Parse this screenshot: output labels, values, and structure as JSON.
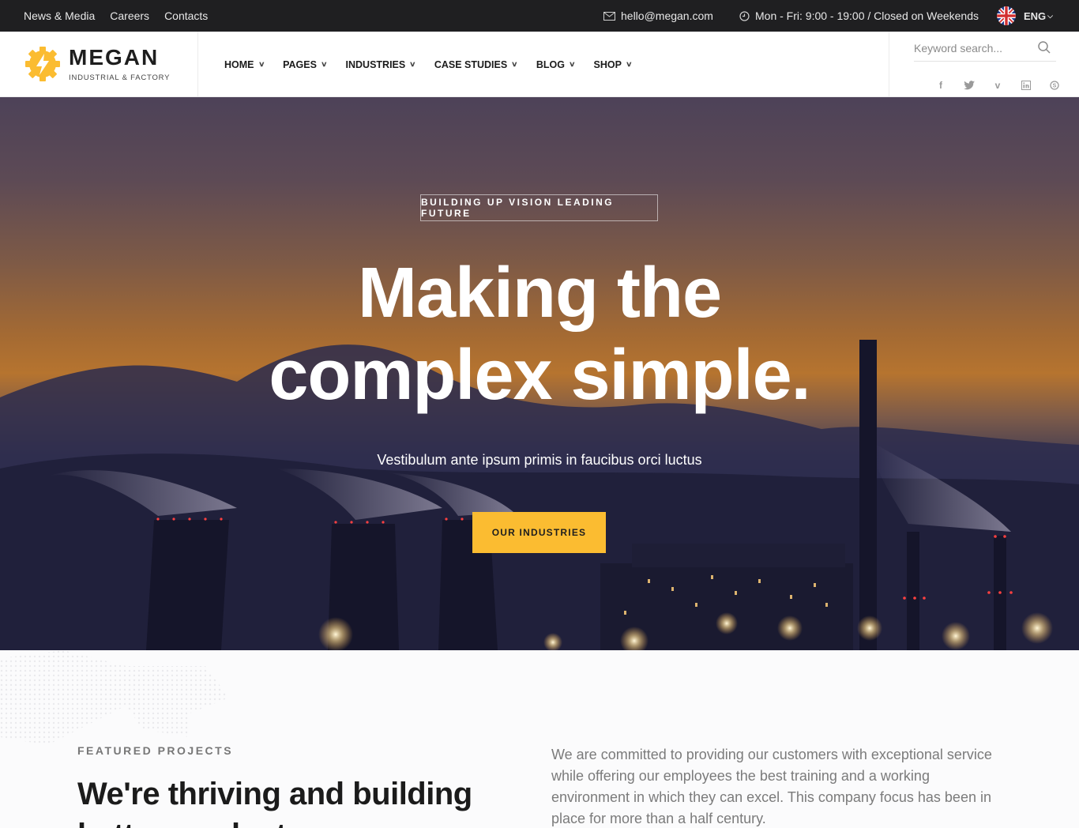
{
  "topbar": {
    "links": [
      "News & Media",
      "Careers",
      "Contacts"
    ],
    "email": "hello@megan.com",
    "hours": "Mon - Fri: 9:00 - 19:00 / Closed on Weekends",
    "language": "ENG"
  },
  "brand": {
    "name": "MEGAN",
    "tagline": "INDUSTRIAL & FACTORY",
    "accent_color": "#fbbc31"
  },
  "nav": {
    "items": [
      "HOME",
      "PAGES",
      "INDUSTRIES",
      "CASE STUDIES",
      "BLOG",
      "SHOP"
    ]
  },
  "search": {
    "placeholder": "Keyword search..."
  },
  "socials": [
    "facebook-icon",
    "twitter-icon",
    "vimeo-icon",
    "linkedin-icon",
    "skype-icon"
  ],
  "hero": {
    "badge": "BUILDING UP VISION LEADING FUTURE",
    "title_line1": "Making the",
    "title_line2": "complex simple.",
    "subtitle": "Vestibulum ante ipsum primis in faucibus orci luctus",
    "cta": "OUR INDUSTRIES"
  },
  "featured": {
    "eyebrow": "FEATURED PROJECTS",
    "heading": "We're thriving and building better products",
    "description": "We are committed to providing our customers with exceptional service while offering our employees the best training and a working environment in which they can excel. This company focus has been in place for more than a half century."
  }
}
